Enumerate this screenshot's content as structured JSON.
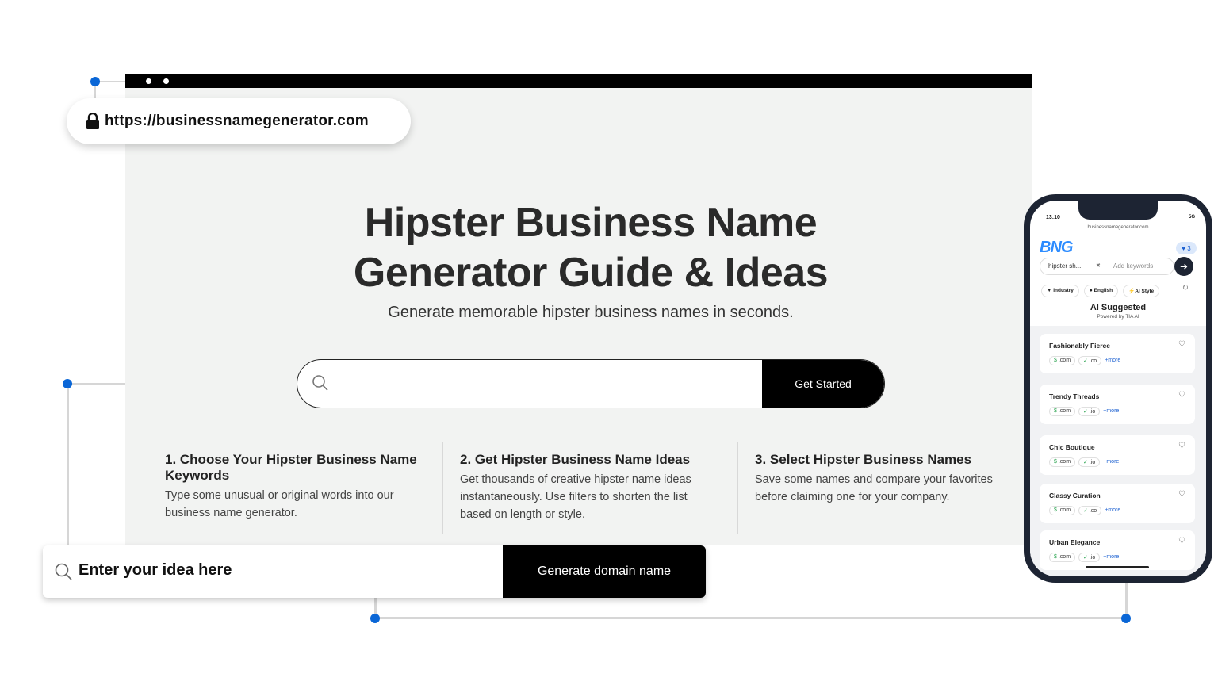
{
  "browser": {
    "url": "https://businessnamegenerator.com"
  },
  "hero": {
    "title_line1": "Hipster Business Name",
    "title_line2": "Generator Guide & Ideas",
    "subtitle": "Generate memorable hipster business names in seconds.",
    "search_placeholder": "",
    "cta_label": "Get Started"
  },
  "steps": [
    {
      "title": "1. Choose Your Hipster Business Name Keywords",
      "body": "Type some unusual or original words into our business name generator."
    },
    {
      "title": "2. Get Hipster Business Name Ideas",
      "body": "Get thousands of creative hipster name ideas instantaneously. Use filters to shorten the list based on length or style."
    },
    {
      "title": "3. Select Hipster Business Names",
      "body": "Save some names and compare your favorites before claiming one for your company."
    }
  ],
  "idea_bar": {
    "placeholder": "Enter your idea here",
    "button_label": "Generate domain name"
  },
  "phone": {
    "time": "13:10",
    "signal": "5G",
    "url": "businessnamegenerator.com",
    "logo": "BNG",
    "favorites_count": "3",
    "search_chip": "hipster sh...",
    "search_placeholder": "Add keywords",
    "filters": [
      "Industry",
      "English",
      "AI Style"
    ],
    "ai_title": "AI Suggested",
    "ai_subtitle": "Powered by TIA AI",
    "more_label": "+more",
    "results": [
      {
        "name": "Fashionably Fierce",
        "tld1": ".com",
        "tld2": ".co"
      },
      {
        "name": "Trendy Threads",
        "tld1": ".com",
        "tld2": ".io"
      },
      {
        "name": "Chic Boutique",
        "tld1": ".com",
        "tld2": ".io"
      },
      {
        "name": "Classy Curation",
        "tld1": ".com",
        "tld2": ".co"
      },
      {
        "name": "Urban Elegance",
        "tld1": ".com",
        "tld2": ".io"
      }
    ]
  },
  "colors": {
    "accent": "#0a66d6",
    "browser_bg": "#f2f3f2",
    "button_bg": "#000000"
  }
}
